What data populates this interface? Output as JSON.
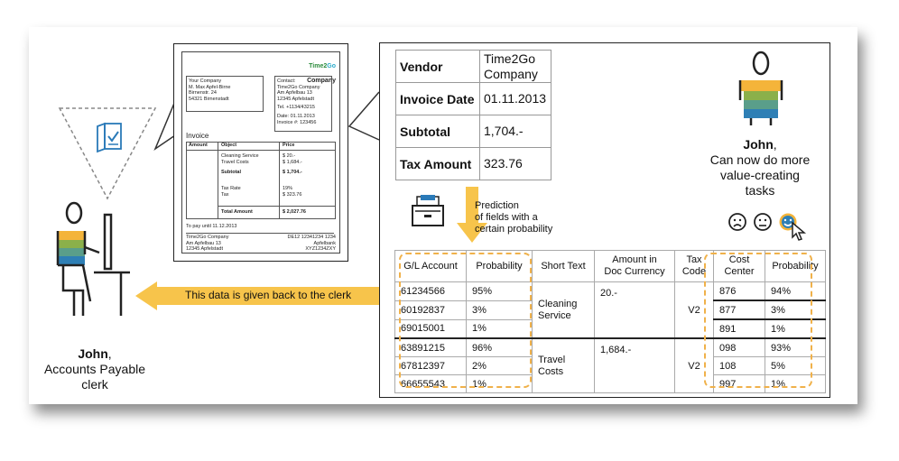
{
  "invoice_doc": {
    "brand_part1": "Time2",
    "brand_part2": "Go",
    "company": "Company",
    "sender_lines": "Your Company\nM. Max Apfel-Birne\nBirnenstr. 24\n54321 Birnenstadt",
    "contact_lines": "Contact:\nTime2Go Company\nAm Apfelbau 13\n12345 Apfelstadt",
    "tel_line": "Tel. +1134/43215",
    "date_line": "Date: 01.11.2013",
    "invoice_no_line": "Invoice #: 123456",
    "title": "Invoice",
    "col_amount": "Amount",
    "col_object": "Object",
    "col_price": "Price",
    "item_lines": "Cleaning Service\nTravel Costs",
    "price_lines": "$ 20.-\n$ 1,684.-",
    "subtotal_label": "Subtotal",
    "subtotal_value": "$ 1,704.-",
    "tax_labels": "Tax Rate\nTax",
    "tax_values": "19%\n$ 323.76",
    "total_label": "Total Amount",
    "total_value": "$ 2,027.76",
    "pay_until": "To pay until 11.12.2013",
    "footer_left": "Time2Go Company\nAm Apfelbau 13\n12345 Apfelstadt",
    "footer_right": "DE12 12341234 1234\nApfelbank\nXYZ1234ZXY"
  },
  "extracted_fields": [
    {
      "label": "Vendor",
      "value": "Time2Go Company"
    },
    {
      "label": "Invoice Date",
      "value": "01.11.2013"
    },
    {
      "label": "Subtotal",
      "value": "1,704.-"
    },
    {
      "label": "Tax Amount",
      "value": "323.76"
    }
  ],
  "prediction_text": "Prediction\nof fields with a\ncertain probability",
  "arrow_label": "This data is given back to the clerk",
  "clerk": {
    "name": "John",
    "role": "Accounts Payable\nclerk"
  },
  "john_after": {
    "name": "John",
    "text": "Can now do more\nvalue-creating\ntasks"
  },
  "gl_table": {
    "headers": [
      "G/L Account",
      "Probability",
      "Short Text",
      "Amount in\nDoc Currency",
      "Tax\nCode",
      "Cost\nCenter",
      "Probability"
    ],
    "rows": [
      {
        "gl": "61234566",
        "p1": "95%",
        "cc": "876",
        "p2": "94%"
      },
      {
        "gl": "60192837",
        "p1": "3%",
        "cc": "877",
        "p2": "3%"
      },
      {
        "gl": "69015001",
        "p1": "1%",
        "cc": "891",
        "p2": "1%"
      },
      {
        "gl": "63891215",
        "p1": "96%",
        "cc": "098",
        "p2": "93%"
      },
      {
        "gl": "67812397",
        "p1": "2%",
        "cc": "108",
        "p2": "5%"
      },
      {
        "gl": "66655543",
        "p1": "1%",
        "cc": "997",
        "p2": "1%"
      }
    ],
    "groups": [
      {
        "short_text": "Cleaning\nService",
        "amount": "20.-",
        "tax": "V2"
      },
      {
        "short_text": "Travel\nCosts",
        "amount": "1,684.-",
        "tax": "V2"
      }
    ]
  },
  "icon_names": [
    "document-check-icon",
    "file-cabinet-icon",
    "sad-face-icon",
    "neutral-face-icon",
    "happy-face-icon",
    "cursor-icon",
    "person-icon"
  ],
  "colors": {
    "accent_orange": "#f0b14a",
    "arrow_yellow": "#f7c44b",
    "icon_blue": "#2a7ab8",
    "brand_teal": "#2aa9c9"
  }
}
